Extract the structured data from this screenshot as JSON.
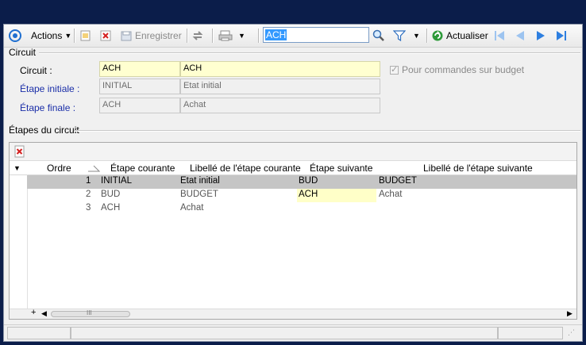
{
  "toolbar": {
    "actions_label": "Actions",
    "save_label": "Enregistrer",
    "search_value": "ACH",
    "refresh_label": "Actualiser"
  },
  "circuit_section": {
    "title": "Circuit",
    "circuit_label": "Circuit :",
    "circuit_code": "ACH",
    "circuit_name": "ACH",
    "start_label": "Étape initiale :",
    "start_code": "INITIAL",
    "start_name": "Etat initial",
    "end_label": "Étape finale :",
    "end_code": "ACH",
    "end_name": "Achat",
    "budget_checkbox_label": "Pour commandes sur budget"
  },
  "steps_section": {
    "title": "Étapes du circuit",
    "columns": [
      "Ordre",
      "Étape courante",
      "Libellé de l'étape courante",
      "Étape suivante",
      "Libellé de l'étape suivante"
    ],
    "rows": [
      {
        "order": "1",
        "current": "INITIAL",
        "current_label": "Etat initial",
        "next": "BUD",
        "next_label": "BUDGET"
      },
      {
        "order": "2",
        "current": "BUD",
        "current_label": "BUDGET",
        "next": "ACH",
        "next_label": "Achat"
      },
      {
        "order": "3",
        "current": "ACH",
        "current_label": "Achat",
        "next": "",
        "next_label": ""
      }
    ],
    "scroll_plus": "+",
    "scroll_marker": "III"
  },
  "colors": {
    "background": "#0b1d4a",
    "field_yellow": "#ffffd0",
    "selected_row": "#c5c5c5",
    "link_label": "#1a2ea8",
    "nav_arrow": "#2e7fe0"
  }
}
